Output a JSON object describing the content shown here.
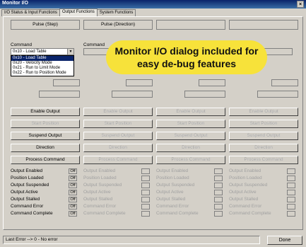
{
  "window": {
    "title": "Monitor I/O",
    "close": "×"
  },
  "tabs": [
    "I/O Status & Input Functions",
    "Output Functions",
    "System Functions"
  ],
  "columns": [
    {
      "header": "Pulse (Step)",
      "command_label": "Command",
      "command_value": "0x10 - Load Table",
      "enabled": true
    },
    {
      "header": "Pulse (Direction)",
      "command_label": "Command",
      "command_value": "",
      "enabled": false
    },
    {
      "header": "",
      "command_label": "",
      "command_value": "",
      "enabled": false
    },
    {
      "header": "",
      "command_label": "",
      "command_value": "",
      "enabled": false
    }
  ],
  "dropdown_options": [
    "0x10 - Load Table",
    "0x20 - Velocity Mode",
    "0x21 - Run to Limit Mode",
    "0x22 - Run to Position Mode"
  ],
  "buttons": [
    "Enable Output",
    "Start Position",
    "Suspend Output",
    "Direction",
    "Process Command"
  ],
  "status_labels": [
    "Output Enabled",
    "Position Loaded",
    "Output Suspended",
    "Output Active",
    "Output Stalled",
    "Command Error",
    "Command Complete"
  ],
  "status_value": "Off",
  "callout": "Monitor I/O dialog included for easy de-bug features",
  "status_bar": "Last Error --> 0 - No error",
  "done_button": "Done"
}
